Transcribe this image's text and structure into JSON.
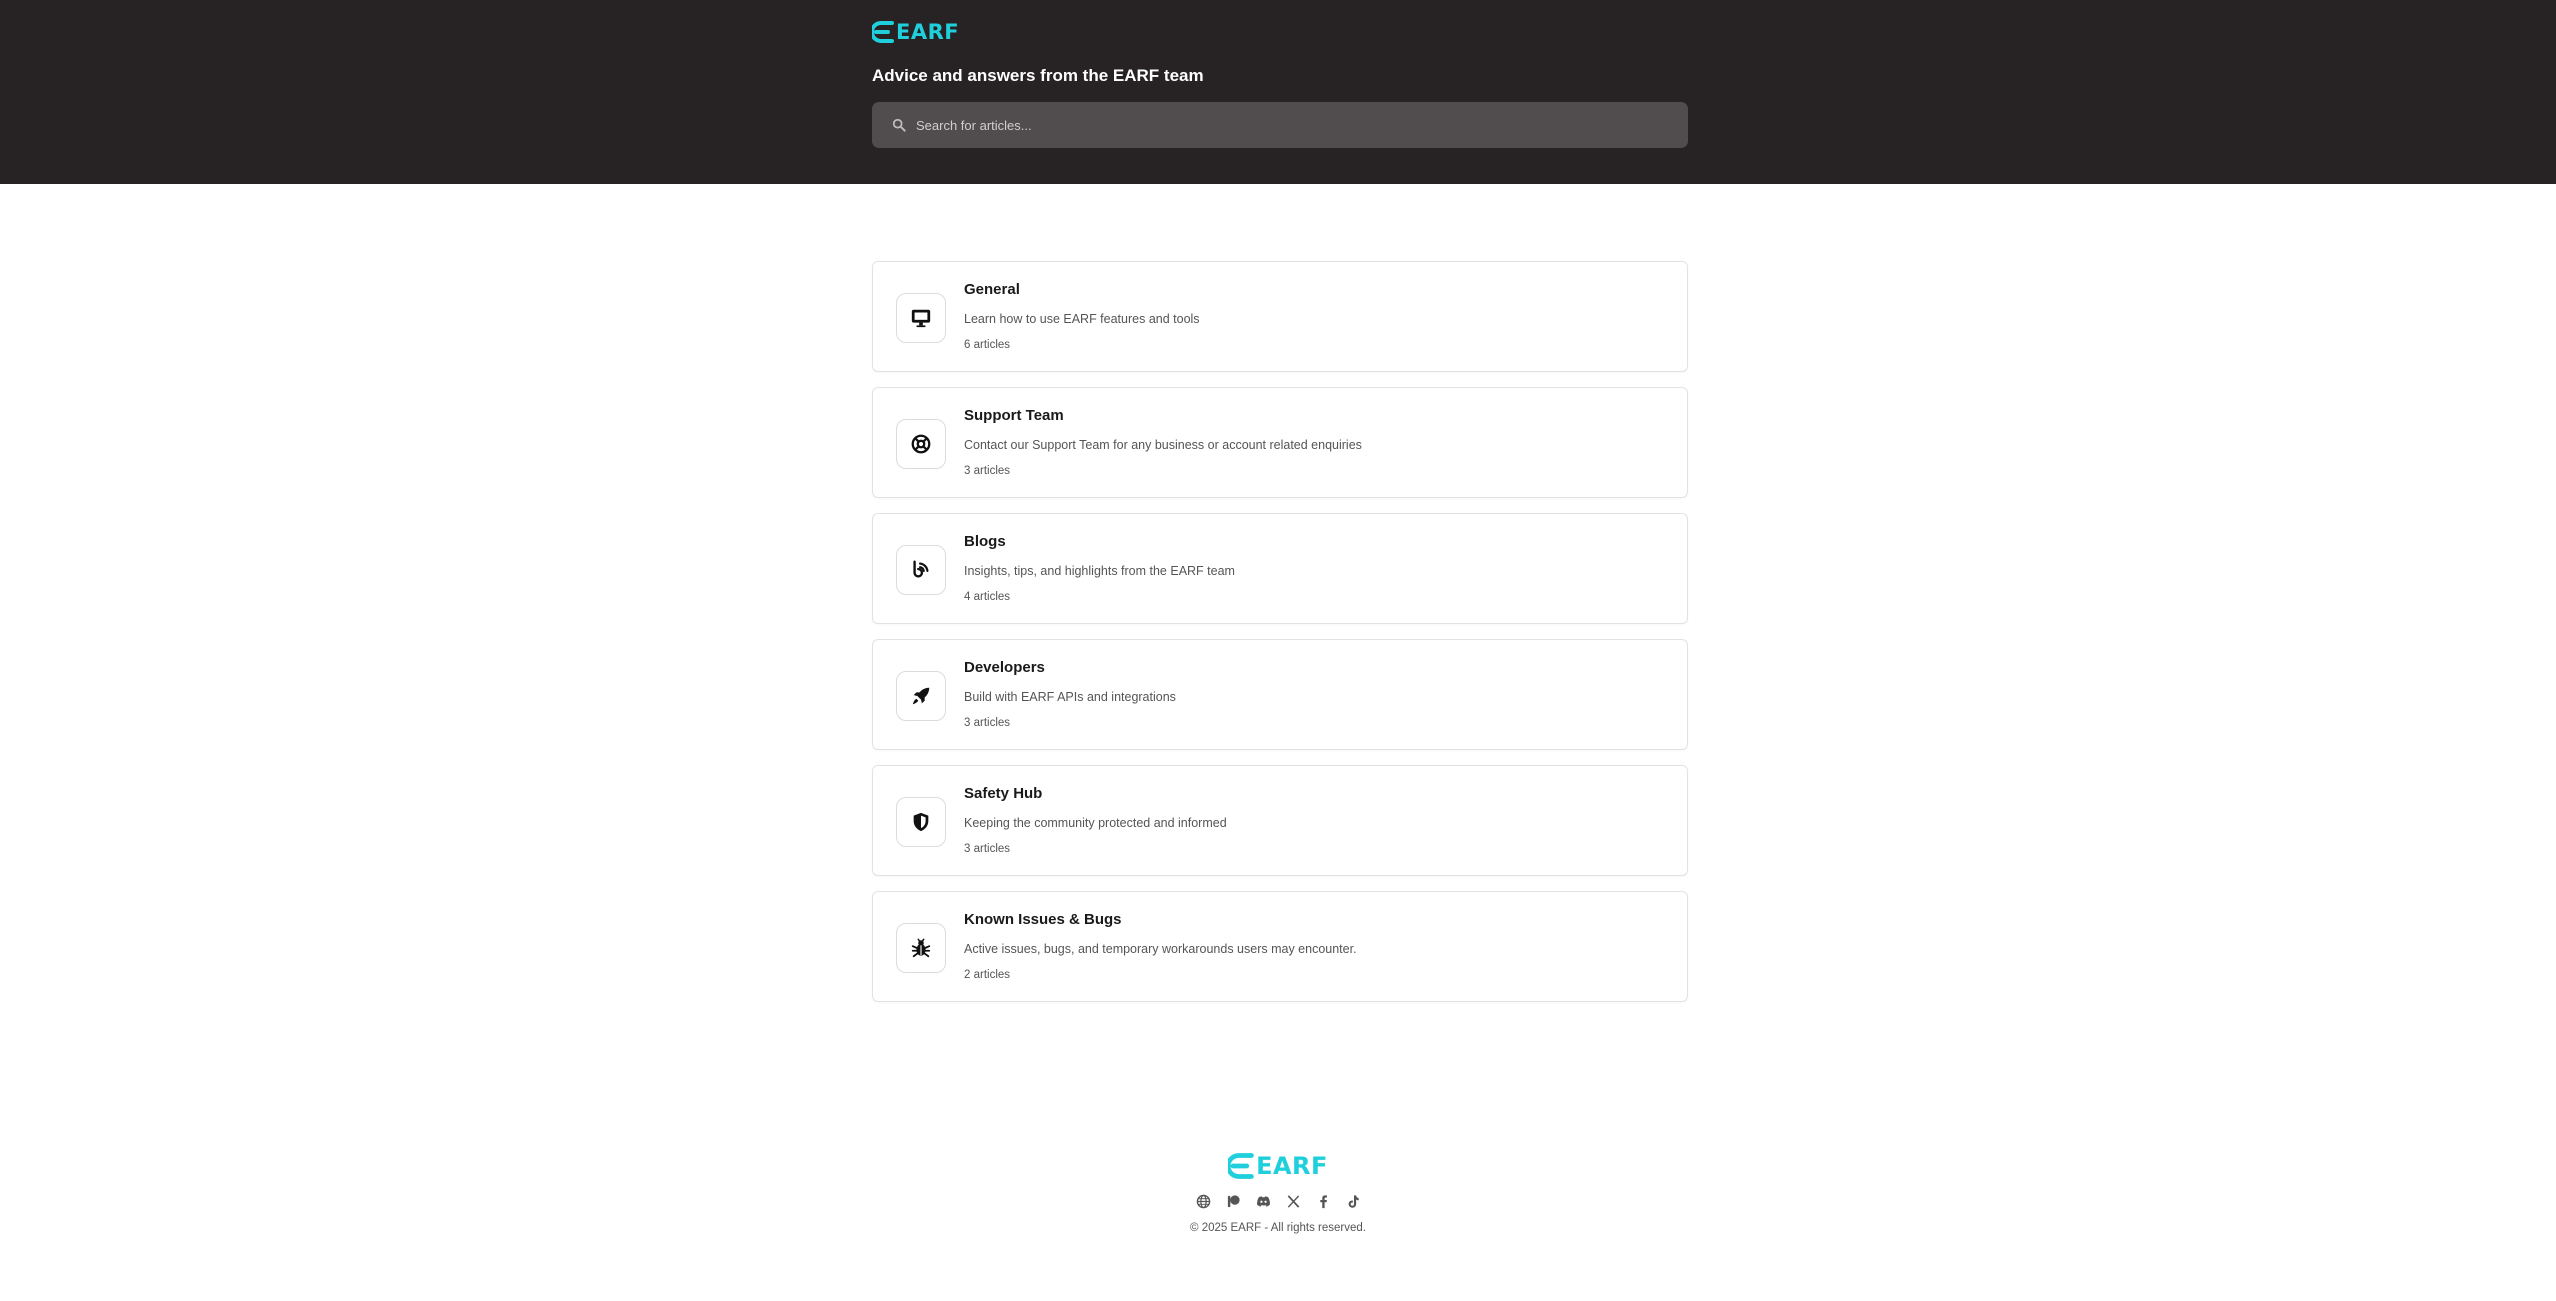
{
  "brand": {
    "name": "EARF",
    "color": "#1fd0dc"
  },
  "header": {
    "background": "#272324",
    "tagline": "Advice and answers from the EARF team"
  },
  "search": {
    "placeholder": "Search for articles...",
    "icon": "search-icon"
  },
  "categories": [
    {
      "title": "General",
      "description": "Learn how to use EARF features and tools",
      "count": "6 articles",
      "icon": "monitor-icon"
    },
    {
      "title": "Support Team",
      "description": "Contact our Support Team for any business or account related enquiries",
      "count": "3 articles",
      "icon": "lifebuoy-icon"
    },
    {
      "title": "Blogs",
      "description": "Insights, tips, and highlights from the EARF team",
      "count": "4 articles",
      "icon": "rss-icon"
    },
    {
      "title": "Developers",
      "description": "Build with EARF APIs and integrations",
      "count": "3 articles",
      "icon": "rocket-icon"
    },
    {
      "title": "Safety Hub",
      "description": "Keeping the community protected and informed",
      "count": "3 articles",
      "icon": "shield-icon"
    },
    {
      "title": "Known Issues & Bugs",
      "description": "Active issues, bugs, and temporary workarounds users may encounter.",
      "count": "2 articles",
      "icon": "bug-icon"
    }
  ],
  "footer": {
    "social": [
      "globe-icon",
      "patreon-icon",
      "discord-icon",
      "x-icon",
      "facebook-icon",
      "tiktok-icon"
    ],
    "copyright": "© 2025 EARF - All rights reserved."
  }
}
